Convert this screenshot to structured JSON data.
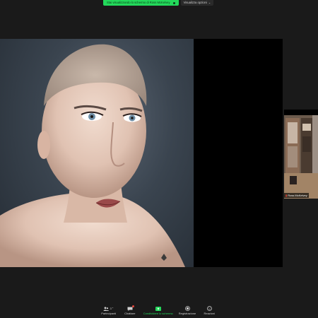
{
  "banner": {
    "sharing_text": "Stai visualizzando lo schermo di Ross McKelvey",
    "view_options_label": "Visualizza opzioni"
  },
  "participant": {
    "name": "Ross McKelvey"
  },
  "toolbar": {
    "participants_label": "Partecipanti",
    "participants_count": "3",
    "chat_label": "Chattare",
    "share_label": "Condividere lo schermo",
    "record_label": "Registrazione",
    "reactions_label": "Reazioni"
  },
  "colors": {
    "share_green": "#23d95b",
    "background": "#1a1a1a",
    "alert_red": "#e5443a"
  }
}
